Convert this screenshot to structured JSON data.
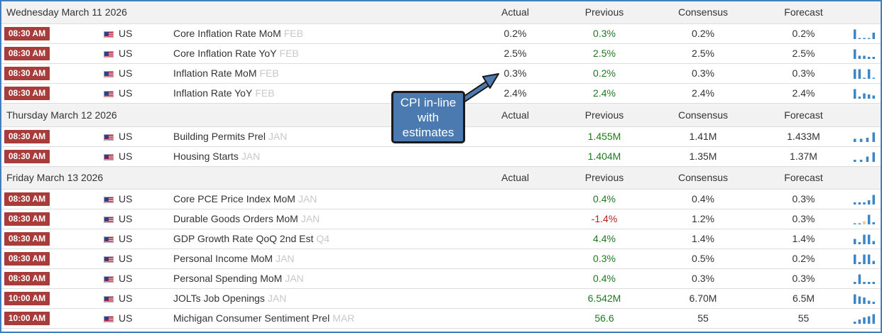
{
  "columns": {
    "actual": "Actual",
    "previous": "Previous",
    "consensus": "Consensus",
    "forecast": "Forecast"
  },
  "sections": [
    {
      "date": "Wednesday March 11 2026",
      "events": [
        {
          "time": "08:30 AM",
          "country": "US",
          "name": "Core Inflation Rate MoM",
          "ref": "FEB",
          "actual": "0.2%",
          "previous": "0.3%",
          "previous_color": "green",
          "consensus": "0.2%",
          "forecast": "0.2%",
          "trend": [
            0.9,
            0.1,
            0.1,
            0.1,
            0.6
          ]
        },
        {
          "time": "08:30 AM",
          "country": "US",
          "name": "Core Inflation Rate YoY",
          "ref": "FEB",
          "actual": "2.5%",
          "previous": "2.5%",
          "previous_color": "green",
          "consensus": "2.5%",
          "forecast": "2.5%",
          "trend": [
            0.9,
            0.3,
            0.3,
            0.2,
            0.2
          ]
        },
        {
          "time": "08:30 AM",
          "country": "US",
          "name": "Inflation Rate MoM",
          "ref": "FEB",
          "actual": "0.3%",
          "previous": "0.2%",
          "previous_color": "green",
          "consensus": "0.3%",
          "forecast": "0.3%",
          "trend": [
            0.9,
            0.9,
            0.1,
            0.9,
            0.1
          ]
        },
        {
          "time": "08:30 AM",
          "country": "US",
          "name": "Inflation Rate YoY",
          "ref": "FEB",
          "actual": "2.4%",
          "previous": "2.4%",
          "previous_color": "green",
          "consensus": "2.4%",
          "forecast": "2.4%",
          "trend": [
            0.9,
            0.2,
            0.5,
            0.4,
            0.3
          ]
        }
      ]
    },
    {
      "date": "Thursday March 12 2026",
      "events": [
        {
          "time": "08:30 AM",
          "country": "US",
          "name": "Building Permits Prel",
          "ref": "JAN",
          "actual": "",
          "previous": "1.455M",
          "previous_color": "green",
          "consensus": "1.41M",
          "forecast": "1.433M",
          "trend": [
            0.3,
            0.3,
            0.4,
            0.9
          ]
        },
        {
          "time": "08:30 AM",
          "country": "US",
          "name": "Housing Starts",
          "ref": "JAN",
          "actual": "",
          "previous": "1.404M",
          "previous_color": "green",
          "consensus": "1.35M",
          "forecast": "1.37M",
          "trend": [
            0.2,
            0.2,
            0.5,
            0.9
          ]
        }
      ]
    },
    {
      "date": "Friday March 13 2026",
      "events": [
        {
          "time": "08:30 AM",
          "country": "US",
          "name": "Core PCE Price Index MoM",
          "ref": "JAN",
          "actual": "",
          "previous": "0.4%",
          "previous_color": "green",
          "consensus": "0.4%",
          "forecast": "0.3%",
          "trend": [
            0.2,
            0.2,
            0.2,
            0.4,
            0.9
          ]
        },
        {
          "time": "08:30 AM",
          "country": "US",
          "name": "Durable Goods Orders MoM",
          "ref": "JAN",
          "actual": "",
          "previous": "-1.4%",
          "previous_color": "red",
          "consensus": "1.2%",
          "forecast": "0.3%",
          "trend": [
            0.1,
            0.1,
            0.3,
            0.9,
            0.2
          ]
        },
        {
          "time": "08:30 AM",
          "country": "US",
          "name": "GDP Growth Rate QoQ 2nd Est",
          "ref": "Q4",
          "actual": "",
          "previous": "4.4%",
          "previous_color": "green",
          "consensus": "1.4%",
          "forecast": "1.4%",
          "trend": [
            0.5,
            0.2,
            0.9,
            0.9,
            0.3
          ]
        },
        {
          "time": "08:30 AM",
          "country": "US",
          "name": "Personal Income MoM",
          "ref": "JAN",
          "actual": "",
          "previous": "0.3%",
          "previous_color": "green",
          "consensus": "0.5%",
          "forecast": "0.2%",
          "trend": [
            0.9,
            0.2,
            0.9,
            0.9,
            0.3
          ]
        },
        {
          "time": "08:30 AM",
          "country": "US",
          "name": "Personal Spending MoM",
          "ref": "JAN",
          "actual": "",
          "previous": "0.4%",
          "previous_color": "green",
          "consensus": "0.3%",
          "forecast": "0.3%",
          "trend": [
            0.2,
            0.9,
            0.2,
            0.2,
            0.2
          ]
        },
        {
          "time": "10:00 AM",
          "country": "US",
          "name": "JOLTs Job Openings",
          "ref": "JAN",
          "actual": "",
          "previous": "6.542M",
          "previous_color": "green",
          "consensus": "6.70M",
          "forecast": "6.5M",
          "trend": [
            0.9,
            0.7,
            0.6,
            0.3,
            0.2
          ]
        },
        {
          "time": "10:00 AM",
          "country": "US",
          "name": "Michigan Consumer Sentiment Prel",
          "ref": "MAR",
          "actual": "",
          "previous": "56.6",
          "previous_color": "green",
          "consensus": "55",
          "forecast": "55",
          "trend": [
            0.2,
            0.4,
            0.6,
            0.7,
            0.9
          ]
        }
      ]
    }
  ],
  "callout": {
    "text": "CPI in-line with estimates",
    "lines": [
      "CPI in-line",
      "with",
      "estimates"
    ]
  },
  "colors": {
    "time_badge": "#a73c3a",
    "positive": "#1d7a1d",
    "negative": "#b22222",
    "spark": "#3d86c6",
    "spark_alt": "#f0c77a",
    "callout": "#4a7ab0",
    "border": "#3f7fbd"
  }
}
